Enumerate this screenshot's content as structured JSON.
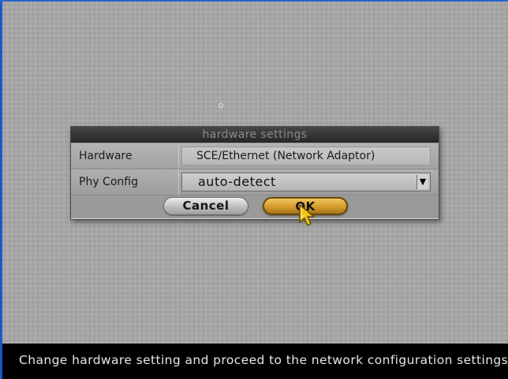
{
  "dialog": {
    "title": "hardware settings",
    "rows": [
      {
        "label": "Hardware",
        "value": "SCE/Ethernet (Network Adaptor)"
      },
      {
        "label": "Phy Config",
        "value": "auto-detect"
      }
    ],
    "buttons": {
      "cancel": "Cancel",
      "ok": "OK"
    }
  },
  "status_bar": {
    "text": "Change hardware setting and proceed to the network configuration settings"
  },
  "icons": {
    "dropdown_arrow": "▼",
    "pointer": "hand-pointer-icon"
  },
  "colors": {
    "ok_button": "#d59c2c",
    "status_bar_bg": "#000000",
    "frame_accent": "#1a57c9"
  }
}
